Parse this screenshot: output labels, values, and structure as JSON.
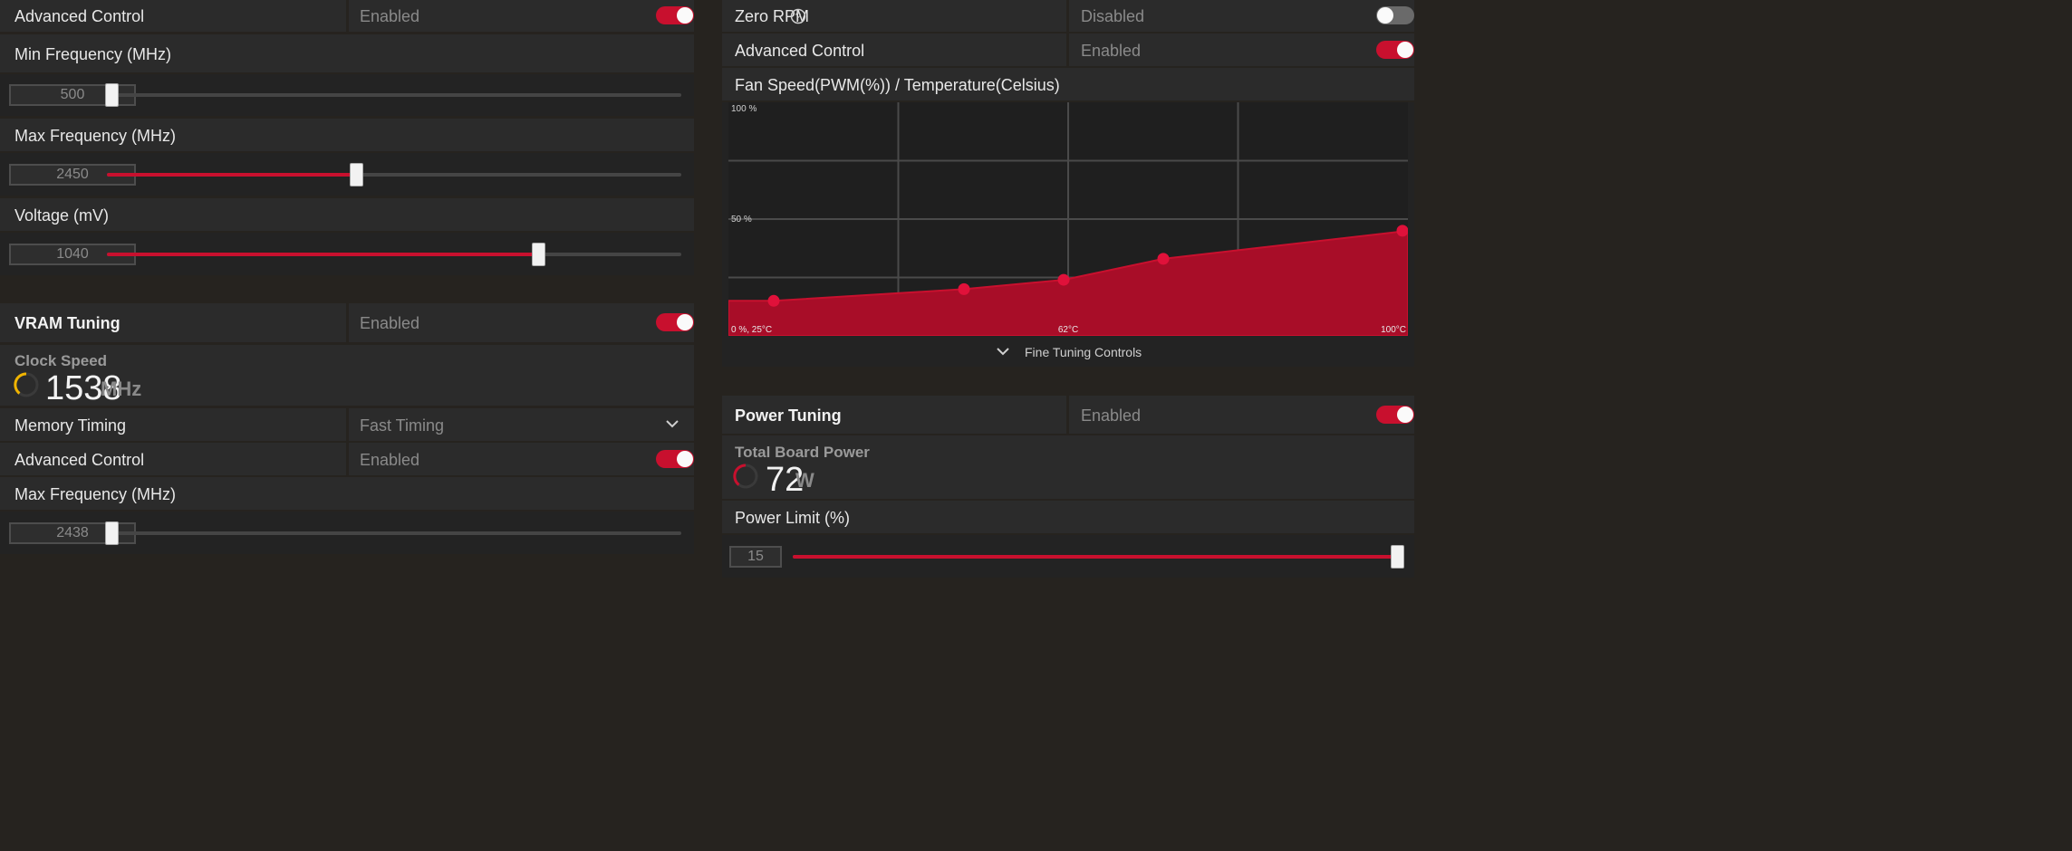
{
  "gpu": {
    "advanced_control": {
      "label": "Advanced Control",
      "value": "Enabled"
    },
    "min_frequency": {
      "label": "Min Frequency (MHz)",
      "value": "500",
      "fraction": 0.0
    },
    "max_frequency": {
      "label": "Max Frequency (MHz)",
      "value": "2450",
      "fraction": 0.435
    },
    "voltage": {
      "label": "Voltage (mV)",
      "value": "1040",
      "fraction": 0.752
    }
  },
  "vram": {
    "title": "VRAM Tuning",
    "status": "Enabled",
    "clock_label": "Clock Speed",
    "clock_value": "1538",
    "clock_unit": "MHz",
    "memory_timing_label": "Memory Timing",
    "memory_timing_value": "Fast Timing",
    "advanced_control": {
      "label": "Advanced Control",
      "value": "Enabled"
    },
    "max_frequency": {
      "label": "Max Frequency (MHz)",
      "value": "2438",
      "fraction": 0.0
    }
  },
  "fan": {
    "zero_rpm_label": "Zero RPM",
    "zero_rpm_value": "Disabled",
    "advanced_control": {
      "label": "Advanced Control",
      "value": "Enabled"
    },
    "chart_title": "Fan Speed(PWM(%)) / Temperature(Celsius)",
    "fine_tuning_label": "Fine Tuning Controls"
  },
  "chart_data": {
    "type": "area",
    "title": "Fan Speed(PWM(%)) / Temperature(Celsius)",
    "xlabel": "Temperature(Celsius)",
    "ylabel": "Fan Speed(PWM(%))",
    "xlim": [
      25,
      100
    ],
    "ylim": [
      0,
      100
    ],
    "y_tick_labels": [
      "100 %",
      "50 %"
    ],
    "x_tick_labels": [
      "0 %, 25°C",
      "62°C",
      "100°C"
    ],
    "grid": true,
    "color": "#c8102e",
    "series": [
      {
        "x": [
          25,
          30,
          51,
          62,
          73,
          100
        ],
        "y": [
          15,
          15,
          20,
          24,
          33,
          45
        ]
      }
    ],
    "control_points": [
      1,
      2,
      3,
      4,
      5
    ]
  },
  "power": {
    "title": "Power Tuning",
    "status": "Enabled",
    "tbp_label": "Total Board Power",
    "tbp_value": "72",
    "tbp_unit": "W",
    "limit": {
      "label": "Power Limit (%)",
      "value": "15",
      "fraction": 1.0
    }
  },
  "colors": {
    "accent": "#c8102e",
    "clock_gauge": "#f0b400",
    "power_gauge": "#c8102e"
  }
}
